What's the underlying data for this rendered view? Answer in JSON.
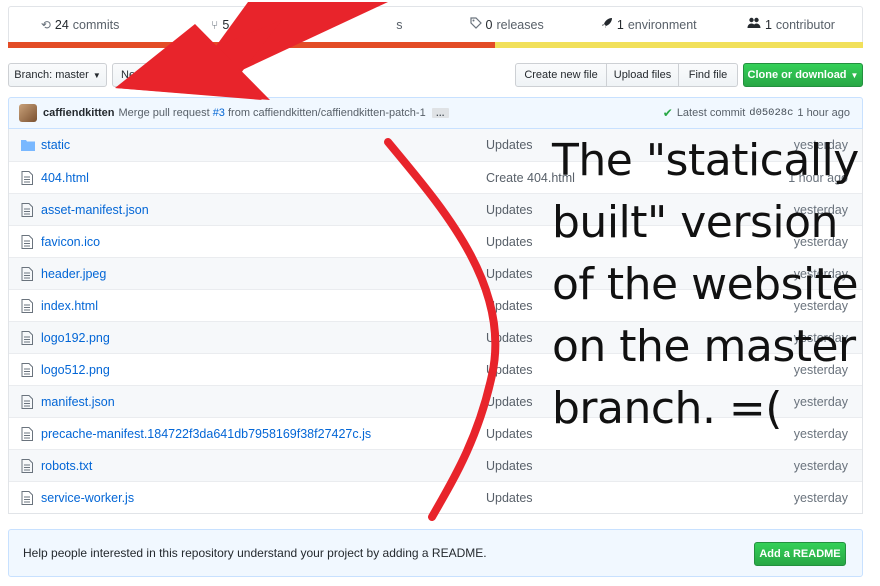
{
  "stats": {
    "commits": {
      "count": "24",
      "label": "commits",
      "icon": "history-icon"
    },
    "branches": {
      "count": "5",
      "label": "",
      "icon": "branch-icon"
    },
    "releases": {
      "count": "0",
      "label": "releases",
      "icon": "tag-icon"
    },
    "environments": {
      "count": "1",
      "label": "environment",
      "icon": "rocket-icon"
    },
    "contributors": {
      "count": "1",
      "label": "contributor",
      "icon": "people-icon"
    },
    "hidden_fragment": "s",
    "language_colors": [
      "#e34c26",
      "#f1e05a"
    ]
  },
  "toolbar": {
    "branch_label": "Branch: master",
    "new_pr_label": "New pull request",
    "create_file_label": "Create new file",
    "upload_files_label": "Upload files",
    "find_file_label": "Find file",
    "clone_label": "Clone or download"
  },
  "commit": {
    "author": "caffiendkitten",
    "message_prefix": "Merge pull request",
    "pr_ref": "#3",
    "message_suffix": "from caffiendkitten/caffiendkitten-patch-1",
    "ellipsis": "…",
    "latest_label": "Latest commit",
    "sha": "d05028c",
    "age": "1 hour ago"
  },
  "files": [
    {
      "name": "static",
      "type": "folder",
      "message": "Updates",
      "age": "yesterday"
    },
    {
      "name": "404.html",
      "type": "file",
      "message": "Create 404.html",
      "age": "1 hour ago"
    },
    {
      "name": "asset-manifest.json",
      "type": "file",
      "message": "Updates",
      "age": "yesterday"
    },
    {
      "name": "favicon.ico",
      "type": "file",
      "message": "Updates",
      "age": "yesterday"
    },
    {
      "name": "header.jpeg",
      "type": "file",
      "message": "Updates",
      "age": "yesterday"
    },
    {
      "name": "index.html",
      "type": "file",
      "message": "Updates",
      "age": "yesterday"
    },
    {
      "name": "logo192.png",
      "type": "file",
      "message": "Updates",
      "age": "yesterday"
    },
    {
      "name": "logo512.png",
      "type": "file",
      "message": "Updates",
      "age": "yesterday"
    },
    {
      "name": "manifest.json",
      "type": "file",
      "message": "Updates",
      "age": "yesterday"
    },
    {
      "name": "precache-manifest.184722f3da641db7958169f38f27427c.js",
      "type": "file",
      "message": "Updates",
      "age": "yesterday"
    },
    {
      "name": "robots.txt",
      "type": "file",
      "message": "Updates",
      "age": "yesterday"
    },
    {
      "name": "service-worker.js",
      "type": "file",
      "message": "Updates",
      "age": "yesterday"
    }
  ],
  "readme": {
    "message": "Help people interested in this repository understand your project by adding a README.",
    "button_label": "Add a README"
  },
  "annotation": {
    "caption": "The \"statically built\" version of the website on the master branch. =(",
    "arrow_color": "#e8242b"
  }
}
